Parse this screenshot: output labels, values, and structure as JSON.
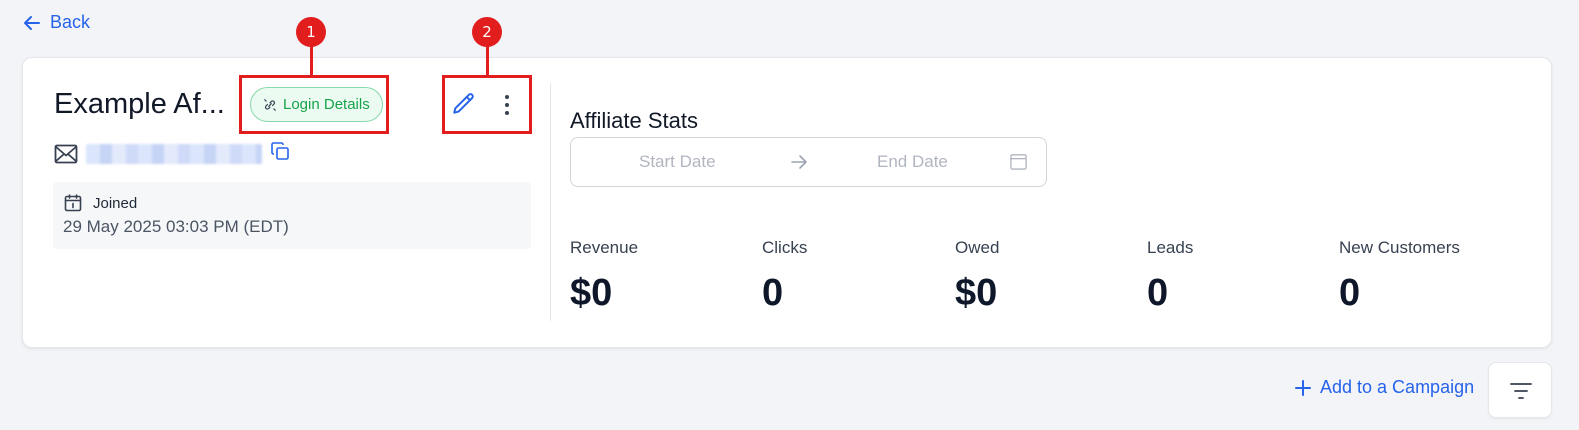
{
  "nav": {
    "back_label": "Back"
  },
  "affiliate": {
    "name": "Example Af...",
    "login_details_label": "Login Details",
    "joined_label": "Joined",
    "joined_date": "29 May 2025 03:03 PM (EDT)"
  },
  "stats": {
    "title": "Affiliate Stats",
    "start_date_placeholder": "Start Date",
    "end_date_placeholder": "End Date",
    "items": [
      {
        "label": "Revenue",
        "value": "$0"
      },
      {
        "label": "Clicks",
        "value": "0"
      },
      {
        "label": "Owed",
        "value": "$0"
      },
      {
        "label": "Leads",
        "value": "0"
      },
      {
        "label": "New Customers",
        "value": "0"
      }
    ]
  },
  "actions": {
    "add_campaign_label": "Add to a Campaign"
  },
  "annotations": {
    "marker_1": "1",
    "marker_2": "2"
  },
  "icons": [
    "arrow-left-icon",
    "link-icon",
    "pencil-icon",
    "more-vertical-icon",
    "mail-icon",
    "copy-icon",
    "calendar-icon",
    "arrow-right-icon",
    "plus-icon",
    "filter-icon"
  ],
  "colors": {
    "accent": "#2563eb",
    "success": "#16a34a",
    "marker": "#e11d1d",
    "background": "#f3f4f7"
  }
}
